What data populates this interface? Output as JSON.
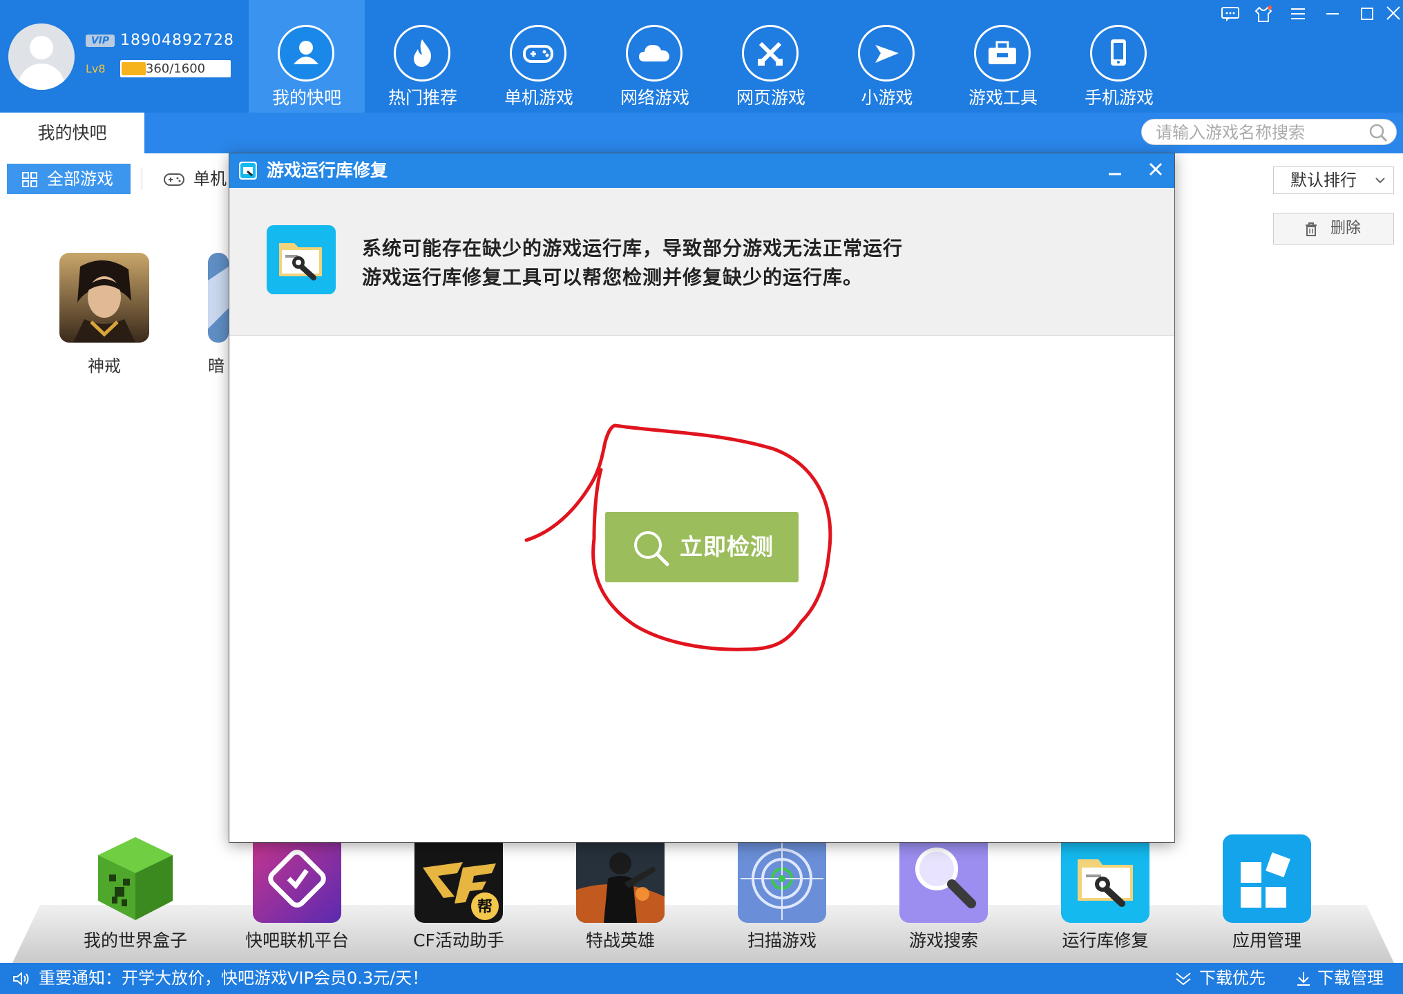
{
  "user": {
    "vip_badge": "VIP",
    "phone": "18904892728",
    "level": "Lv8",
    "exp_text": "360/1600",
    "exp_fraction": 0.225
  },
  "nav": [
    {
      "label": "我的快吧",
      "icon": "user-icon",
      "active": true
    },
    {
      "label": "热门推荐",
      "icon": "flame-icon"
    },
    {
      "label": "单机游戏",
      "icon": "gamepad-icon"
    },
    {
      "label": "网络游戏",
      "icon": "cloud-icon"
    },
    {
      "label": "网页游戏",
      "icon": "crossed-swords-icon"
    },
    {
      "label": "小游戏",
      "icon": "paper-plane-icon"
    },
    {
      "label": "游戏工具",
      "icon": "toolbox-icon"
    },
    {
      "label": "手机游戏",
      "icon": "phone-icon"
    }
  ],
  "window_controls": [
    "feedback-icon",
    "skin-icon",
    "menu-icon",
    "minimize-icon",
    "maximize-icon",
    "close-icon"
  ],
  "tab_active": "我的快吧",
  "search": {
    "placeholder": "请输入游戏名称搜索"
  },
  "filters": {
    "all_games": "全部游戏",
    "single": "单机"
  },
  "sort": {
    "selected": "默认排行"
  },
  "delete_label": "删除",
  "games": [
    {
      "label": "神戒"
    },
    {
      "label": "暗"
    }
  ],
  "dock": [
    {
      "label": "我的世界盒子",
      "icon": "minecraft-creeper-icon"
    },
    {
      "label": "快吧联机平台",
      "icon": "link-platform-icon"
    },
    {
      "label": "CF活动助手",
      "icon": "cf-logo-icon"
    },
    {
      "label": "特战英雄",
      "icon": "soldier-icon"
    },
    {
      "label": "扫描游戏",
      "icon": "radar-scan-icon"
    },
    {
      "label": "游戏搜索",
      "icon": "magnifier-icon"
    },
    {
      "label": "运行库修复",
      "icon": "folder-wrench-icon"
    },
    {
      "label": "应用管理",
      "icon": "app-grid-icon"
    }
  ],
  "status": {
    "notice": "重要通知：开学大放价，快吧游戏VIP会员0.3元/天！",
    "download_priority": "下载优先",
    "download_manage": "下载管理"
  },
  "modal": {
    "title": "游戏运行库修复",
    "line1": "系统可能存在缺少的游戏运行库，导致部分游戏无法正常运行",
    "line2": "游戏运行库修复工具可以帮您检测并修复缺少的运行库。",
    "button_label": "立即检测"
  },
  "colors": {
    "header_blue": "#1f7ce0",
    "detect_green": "#9bbd5c",
    "annotation_red": "#e0141e",
    "info_icon_cyan": "#14b9ef"
  }
}
